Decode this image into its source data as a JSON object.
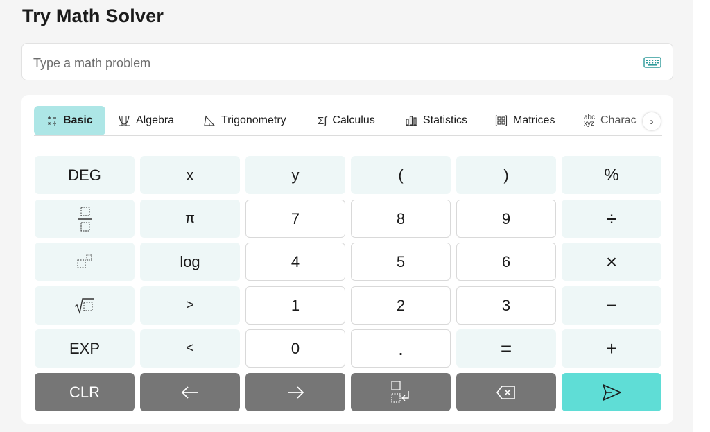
{
  "page": {
    "title": "Try Math Solver"
  },
  "input": {
    "placeholder": "Type a math problem",
    "keyboard_icon": "keyboard-icon"
  },
  "tabs": [
    {
      "label": "Basic",
      "icon": "basic-ops-icon",
      "active": true
    },
    {
      "label": "Algebra",
      "icon": "algebra-icon"
    },
    {
      "label": "Trigonometry",
      "icon": "trigonometry-icon"
    },
    {
      "label": "Calculus",
      "icon": "calculus-icon"
    },
    {
      "label": "Statistics",
      "icon": "statistics-icon"
    },
    {
      "label": "Matrices",
      "icon": "matrices-icon"
    },
    {
      "label": "Charac",
      "icon": "characters-icon"
    }
  ],
  "keys": {
    "deg": "DEG",
    "x": "x",
    "y": "y",
    "lparen": "(",
    "rparen": ")",
    "percent": "%",
    "pi": "π",
    "n7": "7",
    "n8": "8",
    "n9": "9",
    "divide": "÷",
    "log": "log",
    "n4": "4",
    "n5": "5",
    "n6": "6",
    "multiply": "×",
    "gt": ">",
    "n1": "1",
    "n2": "2",
    "n3": "3",
    "minus": "−",
    "exp": "EXP",
    "lt": "<",
    "n0": "0",
    "dot": ".",
    "equals": "=",
    "plus": "+",
    "clr": "CLR"
  },
  "colors": {
    "active_tab": "#ade6e6",
    "function_key": "#eef7f7",
    "dark_key": "#767676",
    "submit_key": "#5fddd6"
  }
}
